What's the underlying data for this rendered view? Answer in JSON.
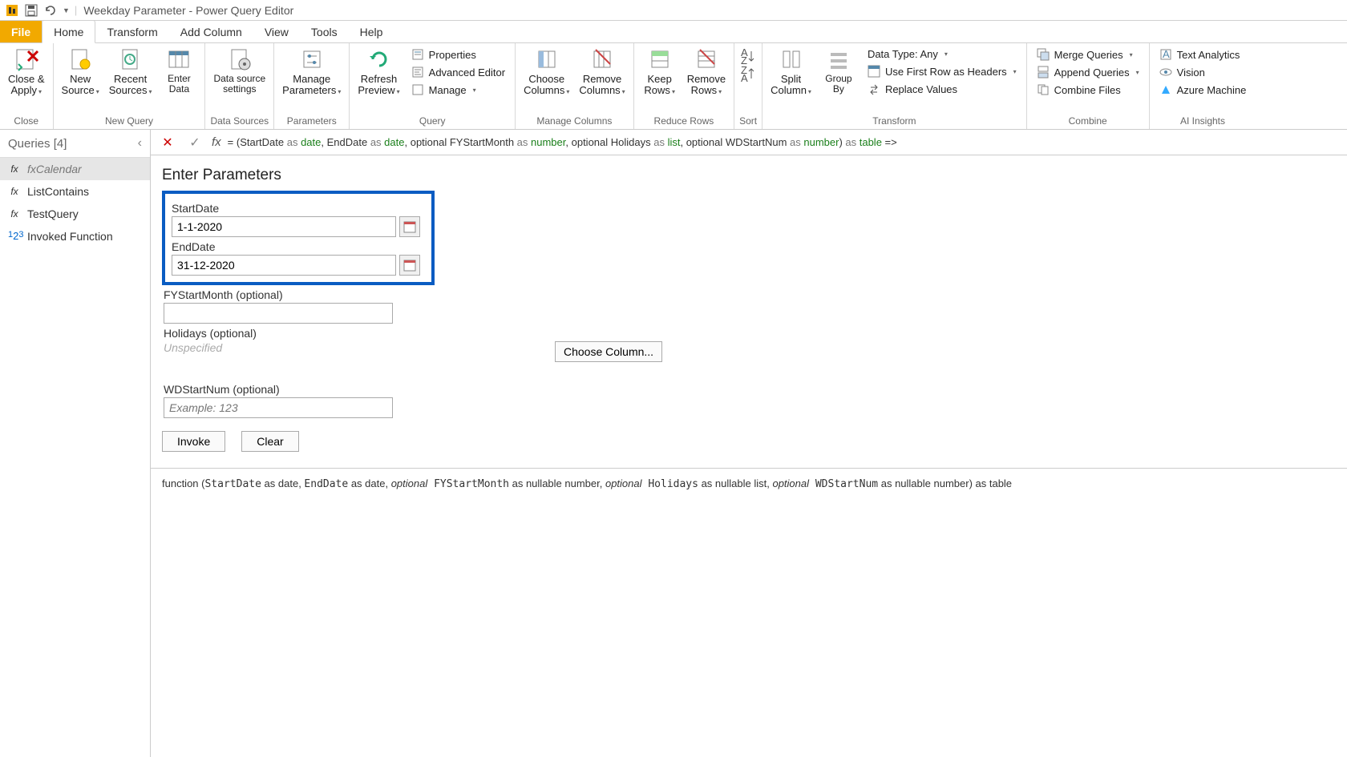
{
  "window": {
    "title": "Weekday Parameter - Power Query Editor"
  },
  "tabs": {
    "file": "File",
    "home": "Home",
    "transform": "Transform",
    "addcolumn": "Add Column",
    "view": "View",
    "tools": "Tools",
    "help": "Help"
  },
  "ribbon": {
    "close": {
      "label": "Close &\nApply",
      "group": "Close"
    },
    "newquery": {
      "new": "New\nSource",
      "recent": "Recent\nSources",
      "enter": "Enter\nData",
      "group": "New Query"
    },
    "datasources": {
      "settings": "Data source\nsettings",
      "group": "Data Sources"
    },
    "parameters": {
      "manage": "Manage\nParameters",
      "group": "Parameters"
    },
    "query": {
      "refresh": "Refresh\nPreview",
      "props": "Properties",
      "adv": "Advanced Editor",
      "manage": "Manage",
      "group": "Query"
    },
    "mcols": {
      "choose": "Choose\nColumns",
      "remove": "Remove\nColumns",
      "group": "Manage Columns"
    },
    "rrows": {
      "keep": "Keep\nRows",
      "remove": "Remove\nRows",
      "group": "Reduce Rows"
    },
    "sort": {
      "group": "Sort"
    },
    "transform": {
      "split": "Split\nColumn",
      "groupby": "Group\nBy",
      "datatype": "Data Type: Any",
      "firstrow": "Use First Row as Headers",
      "replace": "Replace Values",
      "group": "Transform"
    },
    "combine": {
      "merge": "Merge Queries",
      "append": "Append Queries",
      "files": "Combine Files",
      "group": "Combine"
    },
    "ai": {
      "text": "Text Analytics",
      "vision": "Vision",
      "azure": "Azure Machine",
      "group": "AI Insights"
    }
  },
  "queries": {
    "title": "Queries [4]",
    "items": [
      {
        "icon": "fx",
        "name": "fxCalendar"
      },
      {
        "icon": "fx",
        "name": "ListContains"
      },
      {
        "icon": "fx",
        "name": "TestQuery"
      },
      {
        "icon": "123",
        "name": "Invoked Function"
      }
    ]
  },
  "formula": {
    "prefix": "= (StartDate ",
    "as1": "as ",
    "t1": "date",
    "c1": ", EndDate ",
    "as2": "as ",
    "t2": "date",
    "c2": ", optional FYStartMonth ",
    "as3": "as ",
    "t3": "number",
    "c3": ", optional Holidays ",
    "as4": "as ",
    "t4": "list",
    "c4": ", optional WDStartNum ",
    "as5": "as ",
    "t5": "number",
    "tail": ") ",
    "as6": "as ",
    "t6": "table",
    "arrow": " =>"
  },
  "params": {
    "heading": "Enter Parameters",
    "startdate_label": "StartDate",
    "startdate_value": "1-1-2020",
    "enddate_label": "EndDate",
    "enddate_value": "31-12-2020",
    "fystart_label": "FYStartMonth (optional)",
    "fystart_value": "",
    "holidays_label": "Holidays (optional)",
    "unspecified": "Unspecified",
    "choosecol": "Choose Column...",
    "wdstart_label": "WDStartNum (optional)",
    "wdstart_placeholder": "Example: 123",
    "invoke": "Invoke",
    "clear": "Clear"
  },
  "signature": {
    "pre": "function (",
    "p1": "StartDate",
    "p1t": " as date, ",
    "p2": "EndDate",
    "p2t": " as date, ",
    "o": "optional",
    "p3": " FYStartMonth",
    "p3t": " as nullable number, ",
    "p4": " Holidays",
    "p4t": " as nullable list, ",
    "p5": " WDStartNum",
    "p5t": " as nullable number) as table"
  }
}
